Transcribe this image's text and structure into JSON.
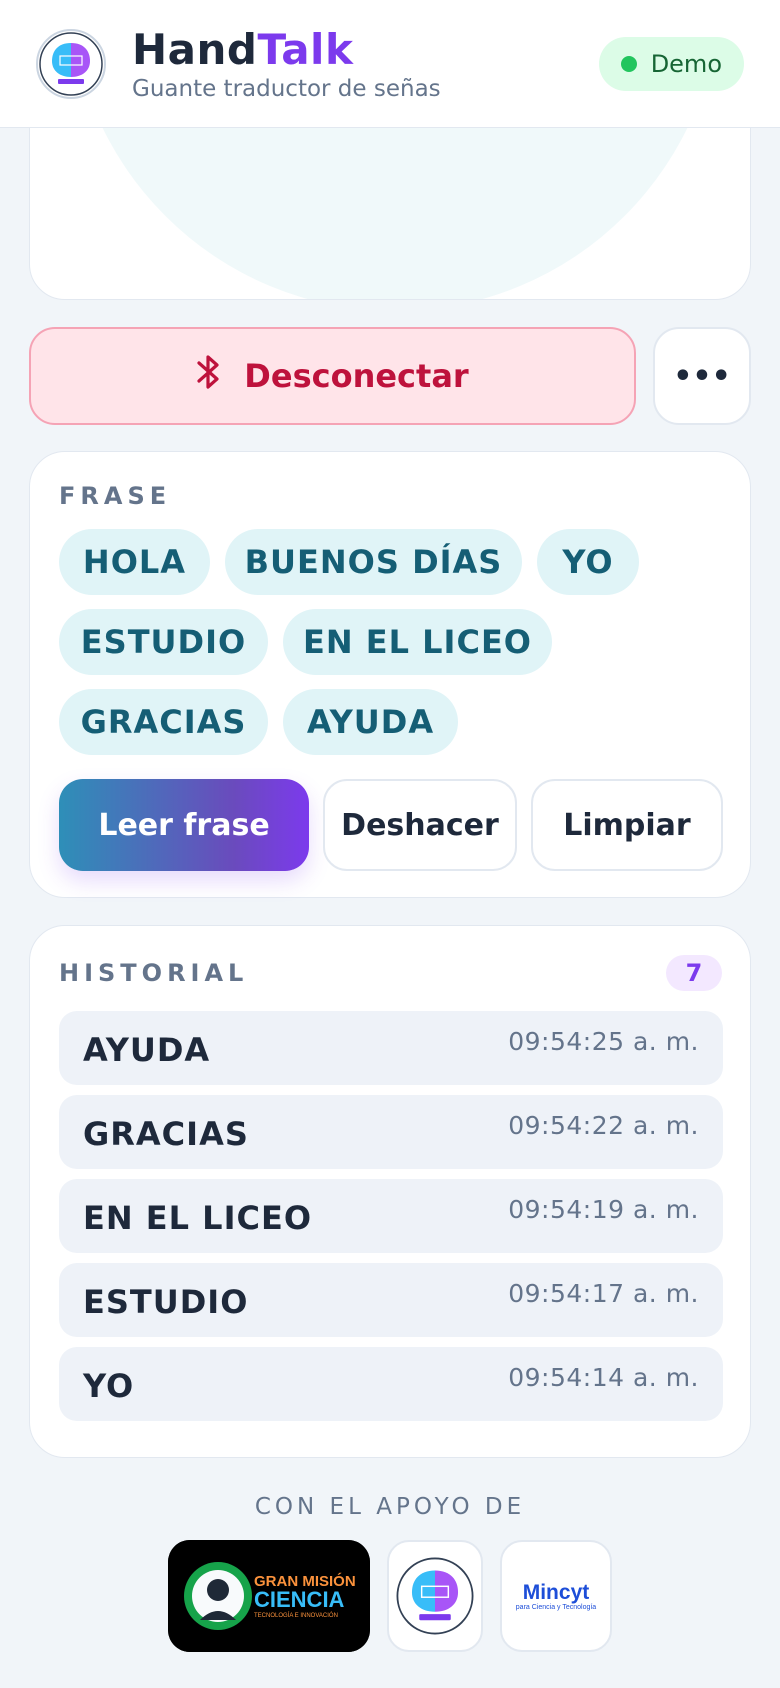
{
  "header": {
    "brand_part1": "Hand",
    "brand_part2": "Talk",
    "subtitle": "Guante traductor de señas",
    "status_label": "Demo",
    "logo_icon": "brigada-brain-logo",
    "colors": {
      "brand_dark": "#1e293b",
      "brand_accent": "#7c3aed",
      "status_green": "#22c55e"
    }
  },
  "connection": {
    "disconnect_label": "Desconectar",
    "disconnect_icon": "bluetooth-icon",
    "more_label": "•••",
    "color": "#be123c"
  },
  "phrase": {
    "section_label": "FRASE",
    "words": [
      "HOLA",
      "BUENOS DÍAS",
      "YO",
      "ESTUDIO",
      "EN EL LICEO",
      "GRACIAS",
      "AYUDA"
    ],
    "read_button": "Leer frase",
    "undo_button": "Deshacer",
    "clear_button": "Limpiar"
  },
  "history": {
    "section_label": "HISTORIAL",
    "count": "7",
    "items": [
      {
        "word": "AYUDA",
        "time": "09:54:25 a. m."
      },
      {
        "word": "GRACIAS",
        "time": "09:54:22 a. m."
      },
      {
        "word": "EN EL LICEO",
        "time": "09:54:19 a. m."
      },
      {
        "word": "ESTUDIO",
        "time": "09:54:17 a. m."
      },
      {
        "word": "YO",
        "time": "09:54:14 a. m."
      }
    ]
  },
  "footer": {
    "support_label": "CON EL APOYO DE",
    "sponsors": {
      "gmc_line1": "GRAN MISIÓN",
      "gmc_line2": "CIENCIA",
      "gmc_line3": "TECNOLOGÍA E INNOVACIÓN",
      "mincyt_name": "Mincyt",
      "mincyt_sub": "para Ciencia y Tecnología"
    }
  }
}
